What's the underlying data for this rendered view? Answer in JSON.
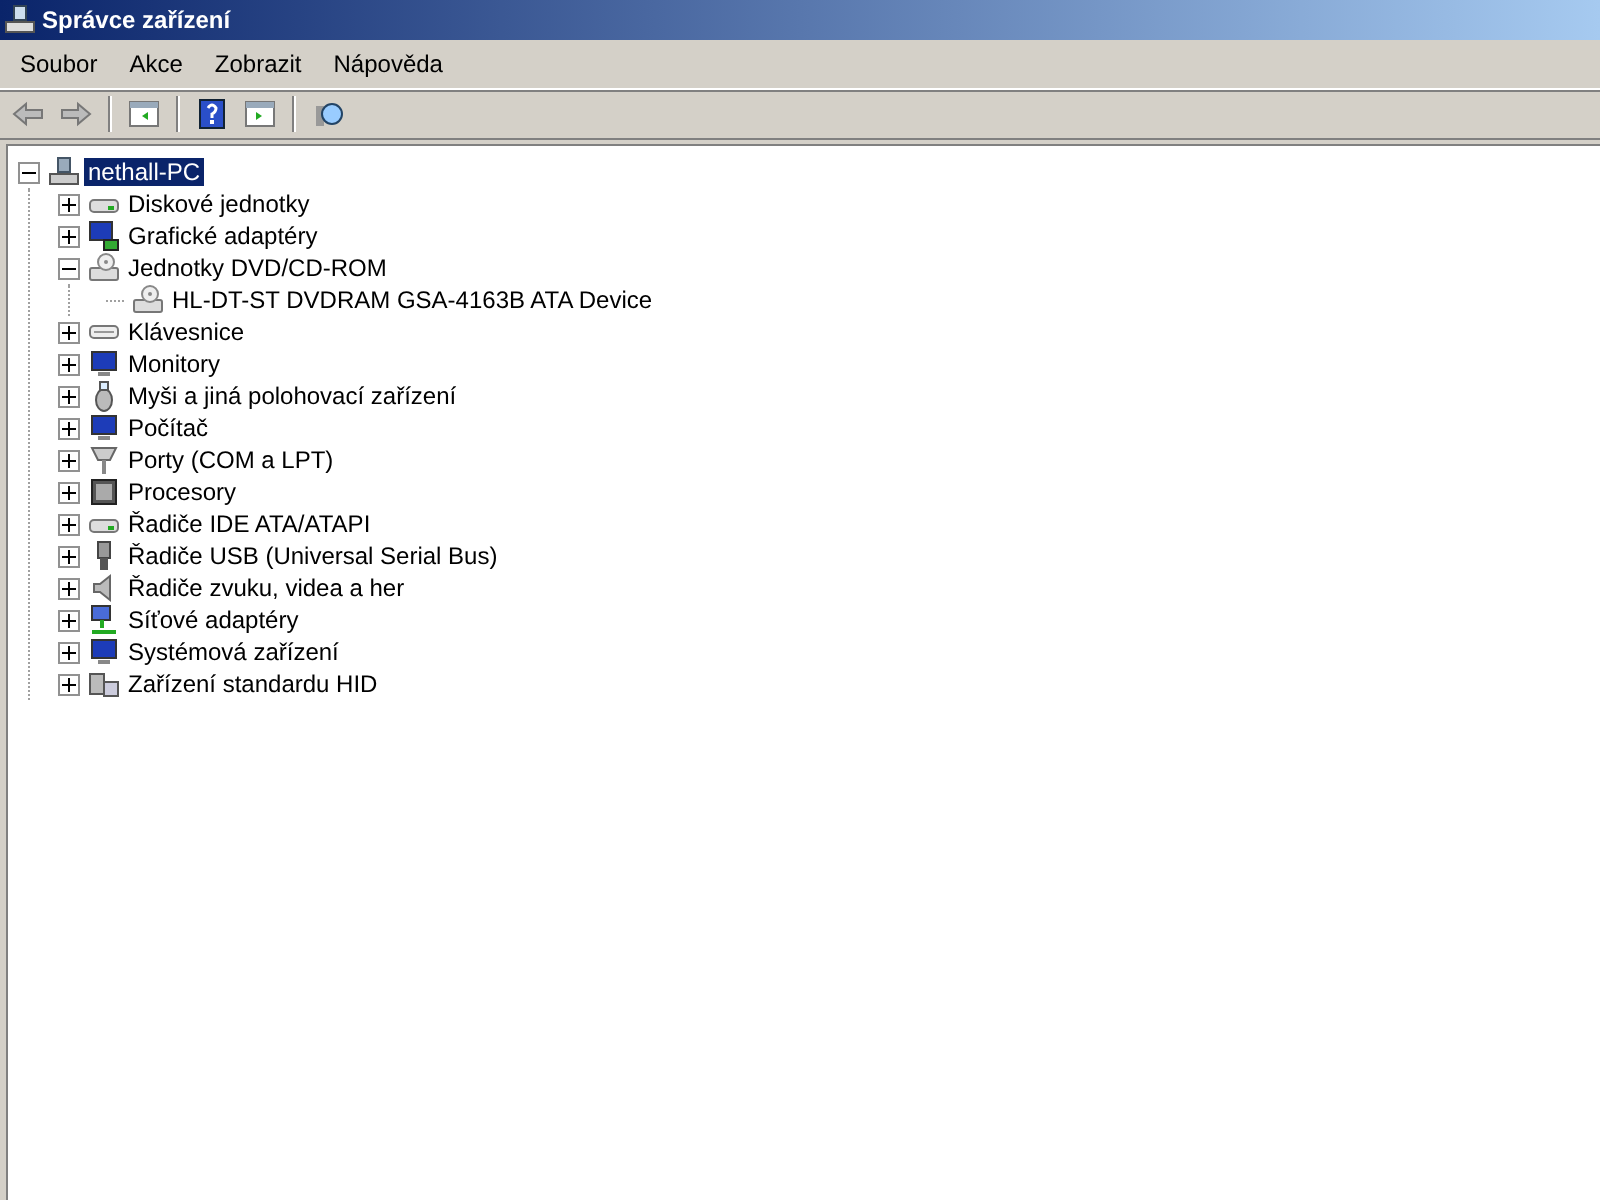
{
  "window": {
    "title": "Správce zařízení"
  },
  "menu": [
    "Soubor",
    "Akce",
    "Zobrazit",
    "Nápověda"
  ],
  "tree": {
    "label": "nethall-PC",
    "kind": "computer",
    "selected": true,
    "expanded": true,
    "children": [
      {
        "label": "Diskové jednotky",
        "kind": "disk",
        "selected": false,
        "expanded": false
      },
      {
        "label": "Grafické adaptéry",
        "kind": "display",
        "selected": false,
        "expanded": false
      },
      {
        "label": "Jednotky DVD/CD-ROM",
        "kind": "dvd",
        "selected": false,
        "expanded": true,
        "children": [
          {
            "label": "HL-DT-ST DVDRAM GSA-4163B ATA Device",
            "kind": "dvd",
            "selected": false
          }
        ]
      },
      {
        "label": "Klávesnice",
        "kind": "keyboard",
        "selected": false,
        "expanded": false
      },
      {
        "label": "Monitory",
        "kind": "monitor",
        "selected": false,
        "expanded": false
      },
      {
        "label": "Myši a jiná polohovací zařízení",
        "kind": "mouse",
        "selected": false,
        "expanded": false
      },
      {
        "label": "Počítač",
        "kind": "monitor",
        "selected": false,
        "expanded": false
      },
      {
        "label": "Porty (COM a LPT)",
        "kind": "port",
        "selected": false,
        "expanded": false
      },
      {
        "label": "Procesory",
        "kind": "cpu",
        "selected": false,
        "expanded": false
      },
      {
        "label": "Řadiče IDE ATA/ATAPI",
        "kind": "disk",
        "selected": false,
        "expanded": false
      },
      {
        "label": "Řadiče USB (Universal Serial Bus)",
        "kind": "usb",
        "selected": false,
        "expanded": false
      },
      {
        "label": "Řadiče zvuku, videa a her",
        "kind": "sound",
        "selected": false,
        "expanded": false
      },
      {
        "label": "Síťové adaptéry",
        "kind": "network",
        "selected": false,
        "expanded": false
      },
      {
        "label": "Systémová zařízení",
        "kind": "monitor",
        "selected": false,
        "expanded": false
      },
      {
        "label": "Zařízení standardu HID",
        "kind": "hid",
        "selected": false,
        "expanded": false
      }
    ]
  }
}
